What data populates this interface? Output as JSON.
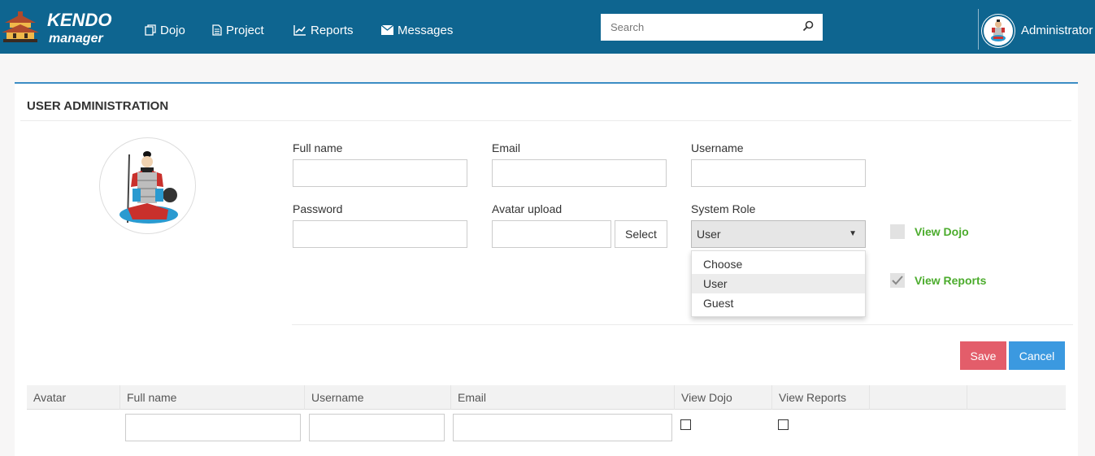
{
  "header": {
    "logo_text": "KENDO manager",
    "nav": [
      {
        "label": "Dojo",
        "icon": "copy-icon"
      },
      {
        "label": "Project",
        "icon": "document-icon"
      },
      {
        "label": "Reports",
        "icon": "line-chart-icon"
      },
      {
        "label": "Messages",
        "icon": "envelope-icon"
      }
    ],
    "search_placeholder": "Search",
    "user_name": "Administrator",
    "bar_color": "#0e6590"
  },
  "panel": {
    "title": "USER ADMINISTRATION",
    "form": {
      "full_name_label": "Full name",
      "email_label": "Email",
      "username_label": "Username",
      "password_label": "Password",
      "avatar_label": "Avatar upload",
      "select_label": "Select",
      "role_label": "System Role",
      "role_value": "User",
      "role_options": [
        "Choose",
        "User",
        "Guest"
      ],
      "view_dojo_label": "View Dojo",
      "view_dojo_checked": false,
      "view_reports_label": "View Reports",
      "view_reports_checked": true,
      "save_label": "Save",
      "cancel_label": "Cancel"
    },
    "table": {
      "columns": [
        "Avatar",
        "Full name",
        "Username",
        "Email",
        "View Dojo",
        "View Reports",
        "",
        ""
      ]
    }
  },
  "colors": {
    "accent": "#3c8dc5",
    "save": "#e35d6a",
    "cancel": "#3b99e0",
    "permission_text": "#4cac2d"
  }
}
